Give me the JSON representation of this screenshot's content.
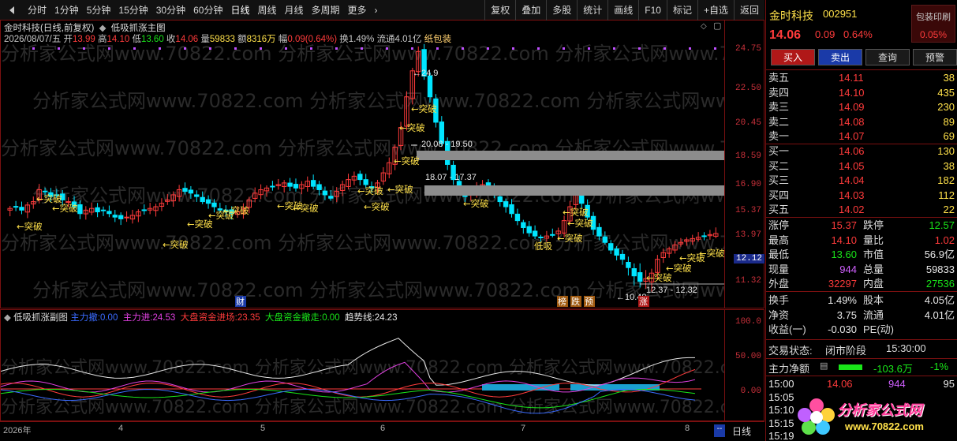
{
  "toolbar": {
    "periods": [
      "分时",
      "1分钟",
      "5分钟",
      "15分钟",
      "30分钟",
      "60分钟",
      "日线",
      "周线",
      "月线",
      "多周期",
      "更多"
    ],
    "active_period": "日线",
    "right_items": [
      "复权",
      "叠加",
      "多股",
      "统计",
      "画线",
      "F10",
      "标记",
      "+自选",
      "返回"
    ]
  },
  "main": {
    "title_line": "金时科技(日线,前复权)",
    "indicator_name": "低吸抓涨主图",
    "date": "2026/08/07/五",
    "open_label": "开",
    "open": "13.99",
    "high_label": "高",
    "high": "14.10",
    "low_label": "低",
    "low": "13.60",
    "close_label": "收",
    "close": "14.06",
    "vol_label": "量",
    "vol": "59833",
    "amount_label": "额",
    "amount": "8316万",
    "amp_label": "幅",
    "amp": "0.09(0.64%)",
    "turnover": "换1.49%",
    "float": "流通4.01亿",
    "concept": "纸包装",
    "zone1": "20.08 - 19.50",
    "zone2": "18.07 - 17.37",
    "zone3": "12.37 - 12.32",
    "peak_label": "24.9",
    "low_point_label": "10.48",
    "breakout_label": "突破",
    "dixi_label": "低吸",
    "badges": [
      "财",
      "榜",
      "跌",
      "预",
      "涨"
    ],
    "watermark": "分析家公式网www.70822.com"
  },
  "price_axis": [
    "24.75",
    "22.50",
    "20.45",
    "18.59",
    "16.90",
    "15.37",
    "13.97",
    "12.12",
    "11.32"
  ],
  "current_price_tag": "12.12",
  "sub": {
    "name": "低吸抓涨副图",
    "main_out_label": "主力撤:",
    "main_out": "0.00",
    "main_in_label": "主力进:",
    "main_in": "24.53",
    "market_in_label": "大盘资金进场:",
    "market_in": "23.35",
    "market_out_label": "大盘资金撤走:",
    "market_out": "0.00",
    "trend_label": "趋势线:",
    "trend": "24.23",
    "axis": [
      "100.0",
      "50.00",
      "0.00"
    ]
  },
  "time_axis": [
    "2026年",
    "4",
    "5",
    "6",
    "7",
    "8"
  ],
  "time_axis_period": "日线",
  "stock": {
    "name": "金时科技",
    "code": "002951",
    "tag_top": "包装印刷",
    "tag_bottom": "0.05%",
    "price": "14.06",
    "change": "0.09",
    "change_pct": "0.64%"
  },
  "actions": [
    "买入",
    "卖出",
    "查询",
    "预警"
  ],
  "asks": [
    {
      "label": "卖五",
      "price": "14.11",
      "vol": "38"
    },
    {
      "label": "卖四",
      "price": "14.10",
      "vol": "435"
    },
    {
      "label": "卖三",
      "price": "14.09",
      "vol": "230"
    },
    {
      "label": "卖二",
      "price": "14.08",
      "vol": "89"
    },
    {
      "label": "卖一",
      "price": "14.07",
      "vol": "69"
    }
  ],
  "bids": [
    {
      "label": "买一",
      "price": "14.06",
      "vol": "130"
    },
    {
      "label": "买二",
      "price": "14.05",
      "vol": "38"
    },
    {
      "label": "买三",
      "price": "14.04",
      "vol": "182"
    },
    {
      "label": "买四",
      "price": "14.03",
      "vol": "112"
    },
    {
      "label": "买五",
      "price": "14.02",
      "vol": "22"
    }
  ],
  "stats": [
    {
      "l1": "涨停",
      "v1": "15.37",
      "c1": "red",
      "l2": "跌停",
      "v2": "12.57",
      "c2": "green"
    },
    {
      "l1": "最高",
      "v1": "14.10",
      "c1": "red",
      "l2": "量比",
      "v2": "1.02",
      "c2": "red"
    },
    {
      "l1": "最低",
      "v1": "13.60",
      "c1": "green",
      "l2": "市值",
      "v2": "56.9亿",
      "c2": "white"
    },
    {
      "l1": "现量",
      "v1": "944",
      "c1": "purple",
      "l2": "总量",
      "v2": "59833",
      "c2": "white"
    },
    {
      "l1": "外盘",
      "v1": "32297",
      "c1": "red",
      "l2": "内盘",
      "v2": "27536",
      "c2": "green"
    }
  ],
  "stats2": [
    {
      "l1": "换手",
      "v1": "1.49%",
      "l2": "股本",
      "v2": "4.05亿"
    },
    {
      "l1": "净资",
      "v1": "3.75",
      "l2": "流通",
      "v2": "4.01亿"
    },
    {
      "l1": "收益(一)",
      "v1": "-0.030",
      "l2": "PE(动)",
      "v2": ""
    }
  ],
  "trade_status_label": "交易状态:",
  "trade_status": "闭市阶段",
  "trade_time": "15:30:00",
  "net_flow_label": "主力净额",
  "net_flow": "-103.6万",
  "net_flow_pct": "-1%",
  "ticks": [
    {
      "time": "15:00",
      "price": "14.06",
      "vol": "944",
      "n": "95"
    },
    {
      "time": "15:05",
      "price": "",
      "vol": "",
      "n": ""
    },
    {
      "time": "15:10",
      "price": "",
      "vol": "",
      "n": ""
    },
    {
      "time": "15:15",
      "price": "",
      "vol": "",
      "n": ""
    },
    {
      "time": "15:19",
      "price": "",
      "vol": "",
      "n": ""
    }
  ],
  "logo_text": "分析家公式网",
  "logo_url": "www.70822.com",
  "colors": {
    "up": "#ff3b3b",
    "down": "#00e5ff",
    "signal": "#ffe14a",
    "zone": "#8c8c8c"
  }
}
